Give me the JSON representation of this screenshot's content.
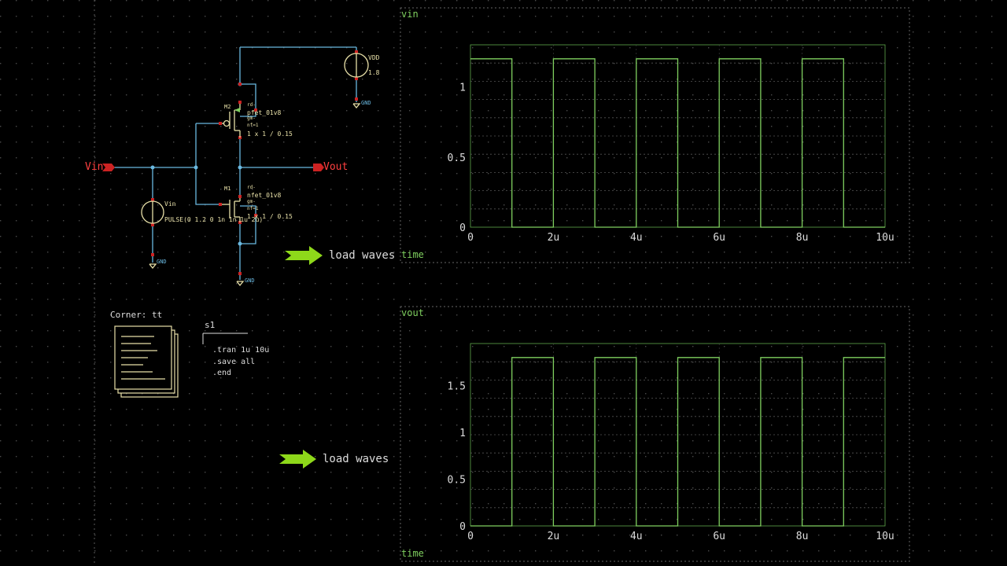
{
  "schematic": {
    "vin_label": "Vin",
    "vout_label": "Vout",
    "vdd_label": "VDD",
    "vdd_value": "1.8",
    "gnd_label": "GND",
    "vin_src_label": "Vin",
    "vin_src_value": "PULSE(0 1.2 0 1n 1n 1u 2u)",
    "m2_label": "M2",
    "m2_model": "pfet_01v8",
    "m2_size": "1 x 1 / 0.15",
    "m1_label": "M1",
    "m1_model": "nfet_01v8",
    "m1_size": "1 x 1 / 0.15",
    "param_rd": "rd-",
    "param_gm": "gm-",
    "param_nf": "nf=1"
  },
  "corner": {
    "label": "Corner: tt"
  },
  "netlist": {
    "name": "s1",
    "lines": [
      ".tran 1u 10u",
      ".save all",
      ".end"
    ]
  },
  "load_waves": [
    "load waves",
    "load waves"
  ],
  "colors": {
    "wire": "#6ab8e0",
    "pin": "#cc2222",
    "component": "#e8e0a8",
    "wave": "#7fcf5f",
    "grid_dot": "#4a4a4a",
    "arrow": "#8ed81a"
  },
  "chart_data": [
    {
      "type": "line",
      "title": "vin",
      "xlabel": "time",
      "ylabel": "",
      "x_ticks": [
        "0",
        "2u",
        "4u",
        "6u",
        "8u",
        "10u"
      ],
      "y_ticks": [
        "0",
        "0.5",
        "1"
      ],
      "xlim": [
        0,
        10
      ],
      "ylim": [
        0,
        1.3
      ],
      "series": [
        {
          "x": [
            0,
            1,
            1,
            2,
            2,
            3,
            3,
            4,
            4,
            5,
            5,
            6,
            6,
            7,
            7,
            8,
            8,
            9,
            9,
            10
          ],
          "y": [
            1.2,
            1.2,
            0,
            0,
            1.2,
            1.2,
            0,
            0,
            1.2,
            1.2,
            0,
            0,
            1.2,
            1.2,
            0,
            0,
            1.2,
            1.2,
            0,
            0
          ]
        }
      ]
    },
    {
      "type": "line",
      "title": "vout",
      "xlabel": "time",
      "ylabel": "",
      "x_ticks": [
        "0",
        "2u",
        "4u",
        "6u",
        "8u",
        "10u"
      ],
      "y_ticks": [
        "0",
        "0.5",
        "1",
        "1.5"
      ],
      "xlim": [
        0,
        10
      ],
      "ylim": [
        0,
        1.95
      ],
      "series": [
        {
          "x": [
            0,
            1,
            1,
            2,
            2,
            3,
            3,
            4,
            4,
            5,
            5,
            6,
            6,
            7,
            7,
            8,
            8,
            9,
            9,
            10
          ],
          "y": [
            0,
            0,
            1.8,
            1.8,
            0,
            0,
            1.8,
            1.8,
            0,
            0,
            1.8,
            1.8,
            0,
            0,
            1.8,
            1.8,
            0,
            0,
            1.8,
            1.8
          ]
        }
      ]
    }
  ]
}
